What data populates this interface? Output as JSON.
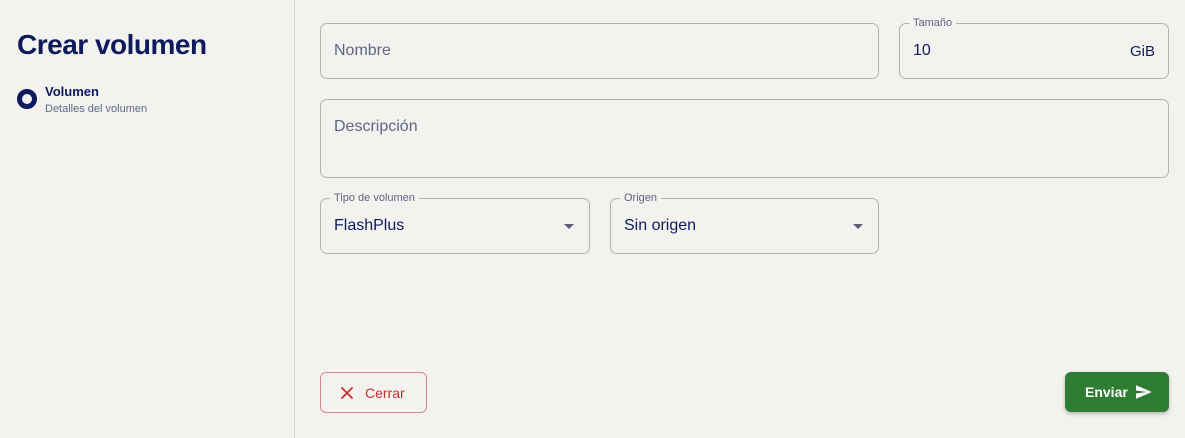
{
  "colors": {
    "brand_navy": "#0d1a5c",
    "primary_green": "#2e7d32",
    "danger_red": "#c4302f"
  },
  "sidebar": {
    "title": "Crear volumen",
    "steps": [
      {
        "label": "Volumen",
        "description": "Detalles del volumen",
        "icon": "step-current-ring-icon"
      }
    ]
  },
  "form": {
    "nombre": {
      "placeholder": "Nombre",
      "value": ""
    },
    "tamano": {
      "label": "Tamaño",
      "value": "10",
      "unit": "GiB"
    },
    "descripcion": {
      "placeholder": "Descripción",
      "value": ""
    },
    "tipo_volumen": {
      "label": "Tipo de volumen",
      "value": "FlashPlus",
      "icon": "dropdown-caret-icon"
    },
    "origen": {
      "label": "Origen",
      "value": "Sin origen",
      "icon": "dropdown-caret-icon"
    }
  },
  "actions": {
    "close": {
      "label": "Cerrar",
      "icon": "close-icon"
    },
    "submit": {
      "label": "Enviar",
      "icon": "send-icon"
    }
  }
}
